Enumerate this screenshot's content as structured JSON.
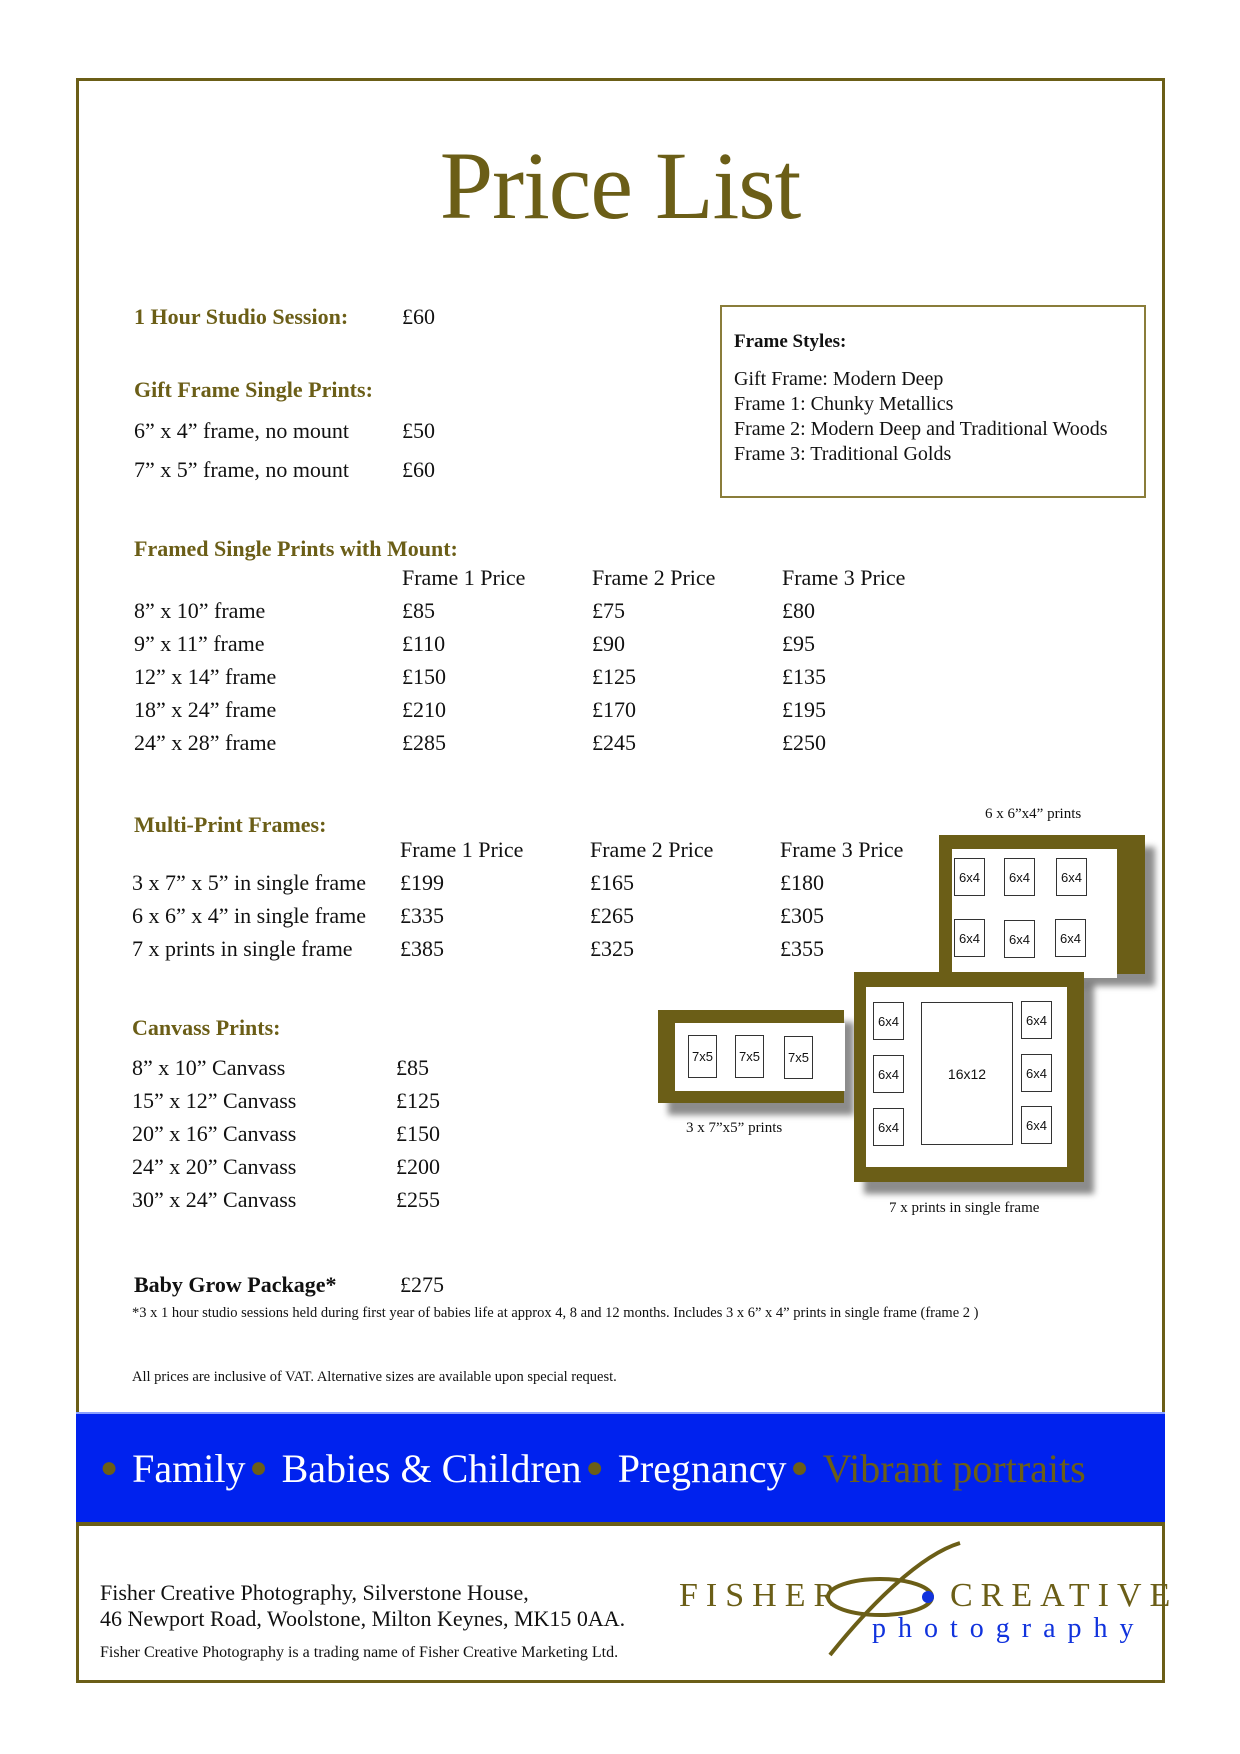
{
  "title": "Price List",
  "studio_session": {
    "label": "1 Hour Studio Session:",
    "price": "£60"
  },
  "gift_frame": {
    "heading": "Gift Frame Single Prints:",
    "rows": [
      {
        "label": "6” x 4” frame, no mount",
        "price": "£50"
      },
      {
        "label": "7” x 5” frame, no mount",
        "price": "£60"
      }
    ]
  },
  "frame_styles": {
    "title": "Frame Styles:",
    "items": [
      "Gift Frame: Modern Deep",
      "Frame 1: Chunky Metallics",
      "Frame 2: Modern Deep and Traditional Woods",
      "Frame 3: Traditional Golds"
    ]
  },
  "framed_single": {
    "heading": "Framed Single Prints with Mount:",
    "columns": [
      "Frame 1 Price",
      "Frame 2 Price",
      "Frame 3 Price"
    ],
    "rows": [
      {
        "label": "8” x 10” frame",
        "prices": [
          "£85",
          "£75",
          "£80"
        ]
      },
      {
        "label": "9” x 11” frame",
        "prices": [
          "£110",
          "£90",
          "£95"
        ]
      },
      {
        "label": "12” x 14” frame",
        "prices": [
          "£150",
          "£125",
          "£135"
        ]
      },
      {
        "label": "18” x 24” frame",
        "prices": [
          "£210",
          "£170",
          "£195"
        ]
      },
      {
        "label": "24” x 28” frame",
        "prices": [
          "£285",
          "£245",
          "£250"
        ]
      }
    ]
  },
  "multi_print": {
    "heading": "Multi-Print Frames:",
    "columns": [
      "Frame 1 Price",
      "Frame 2 Price",
      "Frame 3 Price"
    ],
    "rows": [
      {
        "label": "3 x 7” x 5” in single frame",
        "prices": [
          "£199",
          "£165",
          "£180"
        ]
      },
      {
        "label": "6 x 6” x 4” in single frame",
        "prices": [
          "£335",
          "£265",
          "£305"
        ]
      },
      {
        "label": "7 x prints in single frame",
        "prices": [
          "£385",
          "£325",
          "£355"
        ]
      }
    ]
  },
  "canvas": {
    "heading": "Canvass Prints:",
    "rows": [
      {
        "label": "8” x 10” Canvass",
        "price": "£85"
      },
      {
        "label": "15” x 12” Canvass",
        "price": "£125"
      },
      {
        "label": "20” x 16” Canvass",
        "price": "£150"
      },
      {
        "label": "24” x 20” Canvass",
        "price": "£200"
      },
      {
        "label": "30” x 24” Canvass",
        "price": "£255"
      }
    ]
  },
  "illustrations": {
    "six": {
      "caption": "6 x 6”x4” prints",
      "label": "6x4"
    },
    "three": {
      "caption": "3 x 7”x5” prints",
      "label": "7x5"
    },
    "seven": {
      "caption": "7 x prints in single frame",
      "small": "6x4",
      "large": "16x12"
    }
  },
  "baby_grow": {
    "label": "Baby Grow Package*",
    "price": "£275",
    "footnote": "*3 x 1 hour studio sessions held during first year of babies life at approx 4, 8 and 12 months.  Includes 3 x 6” x 4” prints in single frame (frame 2 )"
  },
  "vat_note": "All prices are inclusive of VAT.  Alternative sizes are available upon special request.",
  "banner": {
    "items": [
      "Family",
      "Babies & Children",
      "Pregnancy",
      "Vibrant portraits"
    ],
    "colors": {
      "background": "#0022ee",
      "text": "#ffffff",
      "accent": "#6b5e17"
    }
  },
  "footer": {
    "address_line1": "Fisher Creative Photography, Silverstone House,",
    "address_line2": "46 Newport Road, Woolstone, Milton Keynes, MK15 0AA.",
    "trading_note": "Fisher Creative Photography is a trading name of Fisher Creative Marketing Ltd.",
    "logo_left": "FISHER",
    "logo_right": "CREATIVE",
    "logo_sub": "photography"
  }
}
